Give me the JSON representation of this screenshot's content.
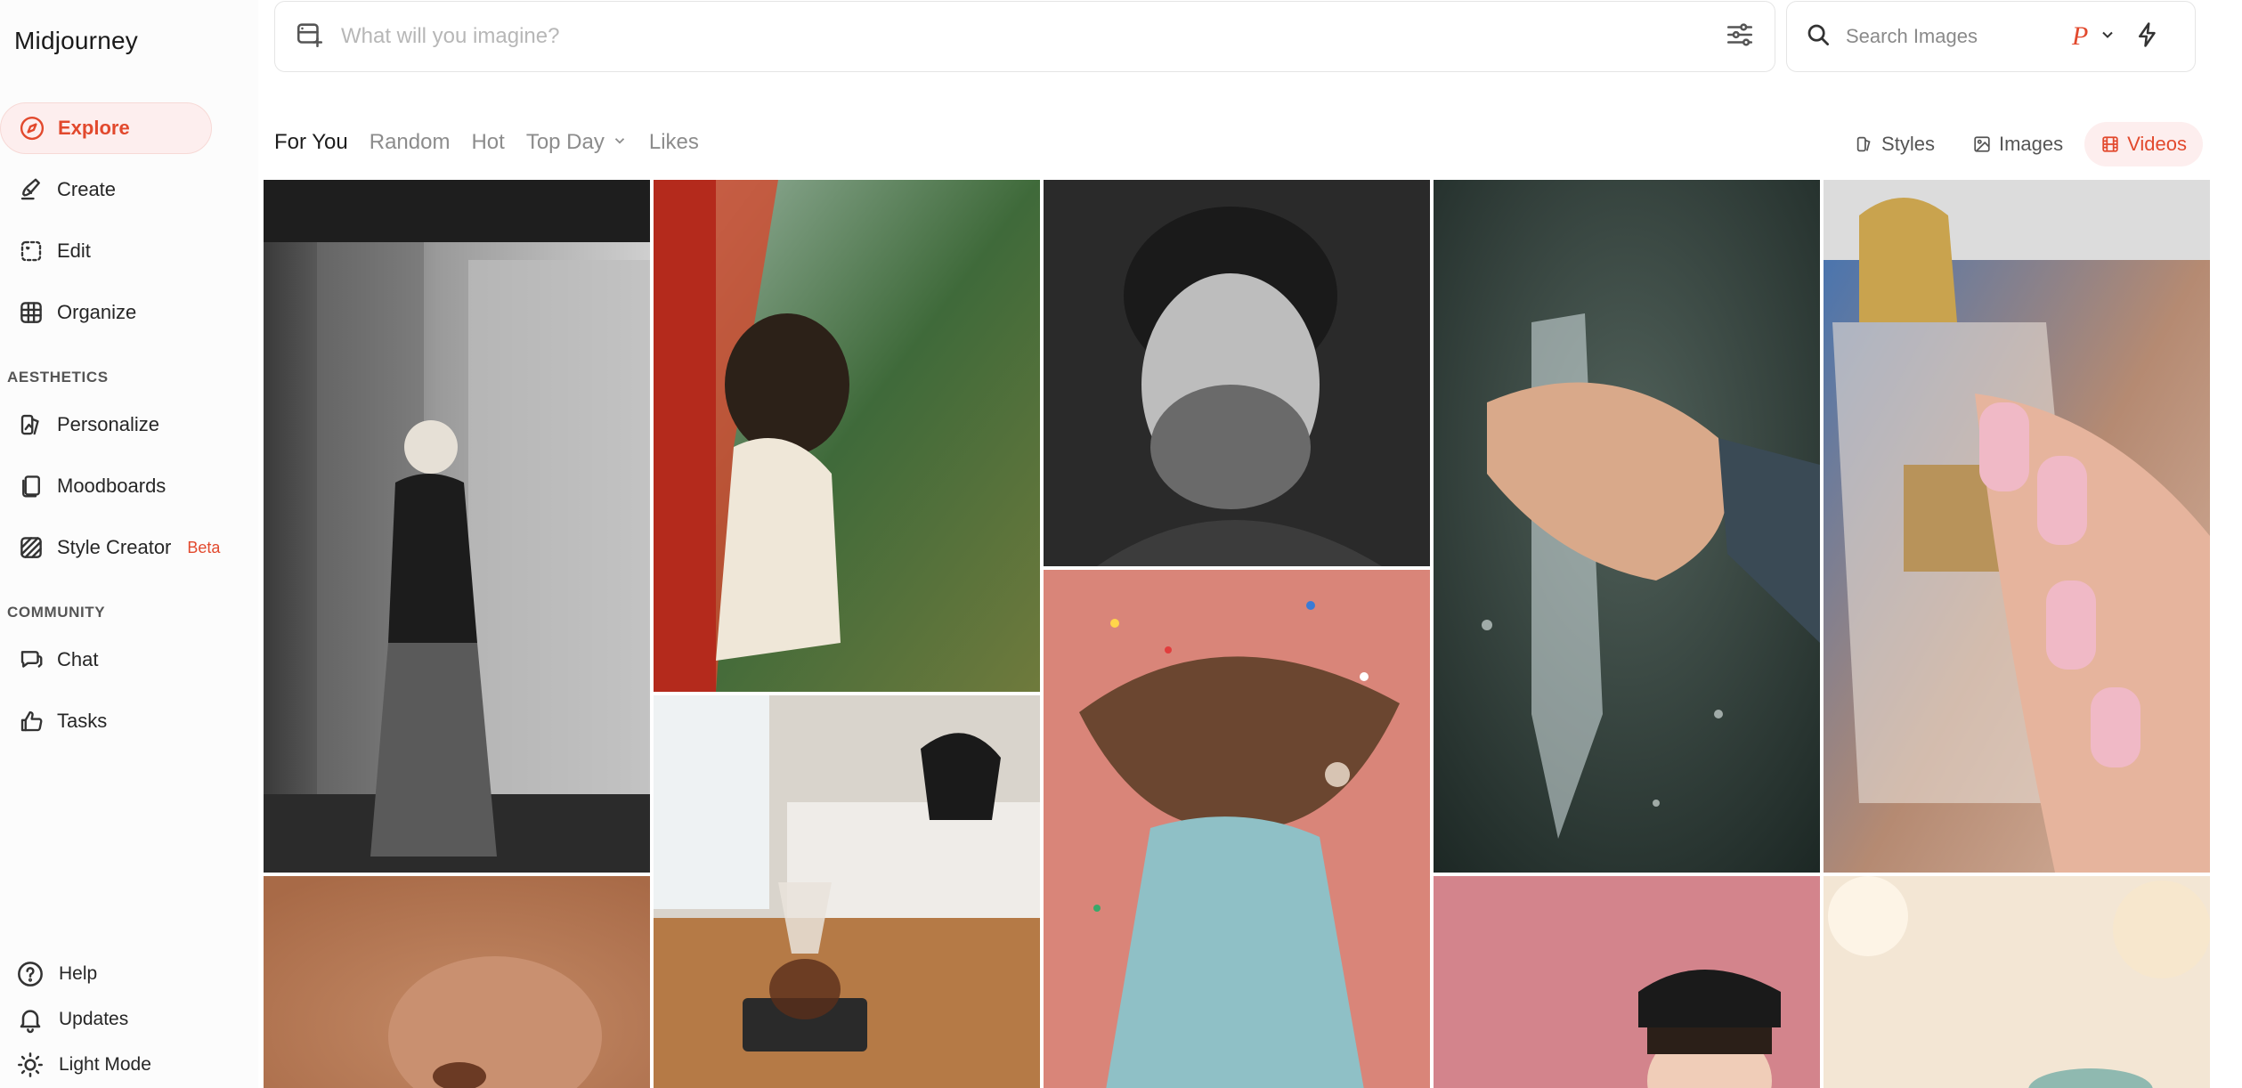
{
  "brand": "Midjourney",
  "nav": {
    "explore": "Explore",
    "create": "Create",
    "edit": "Edit",
    "organize": "Organize",
    "aesthetics_heading": "AESTHETICS",
    "personalize": "Personalize",
    "moodboards": "Moodboards",
    "style_creator": "Style Creator",
    "beta_badge": "Beta",
    "community_heading": "COMMUNITY",
    "chat": "Chat",
    "tasks": "Tasks"
  },
  "footer": {
    "help": "Help",
    "updates": "Updates",
    "light_mode": "Light Mode"
  },
  "prompt": {
    "placeholder": "What will you imagine?",
    "value": ""
  },
  "search": {
    "placeholder": "Search Images",
    "value": "",
    "profile_initial": "P"
  },
  "tabs": {
    "for_you": "For You",
    "random": "Random",
    "hot": "Hot",
    "top_day": "Top Day",
    "likes": "Likes",
    "active": "For You"
  },
  "filters": {
    "styles": "Styles",
    "images": "Images",
    "videos": "Videos",
    "active": "Videos"
  },
  "icons": {
    "explore": "compass-icon",
    "create": "brush-icon",
    "edit": "edit-selection-icon",
    "organize": "grid-icon",
    "personalize": "personalize-icon",
    "moodboards": "moodboards-icon",
    "style_creator": "style-creator-icon",
    "chat": "chat-icon",
    "tasks": "thumbs-up-icon",
    "help": "help-icon",
    "updates": "bell-icon",
    "light_mode": "sun-icon"
  },
  "colors": {
    "accent": "#e2492d",
    "accent_bg": "#fdeeee"
  },
  "gallery": {
    "tiles": [
      {
        "name": "woman-by-train-bw"
      },
      {
        "name": "girl-leaning-from-train-window"
      },
      {
        "name": "smiling-bearded-man-bw"
      },
      {
        "name": "hand-with-water-bottle-splash"
      },
      {
        "name": "manicured-nails-perfume-bottle"
      },
      {
        "name": "pour-over-coffee-kettle"
      },
      {
        "name": "hair-flip-confetti"
      },
      {
        "name": "close-up-freckled-nose"
      },
      {
        "name": "girl-in-black-beret"
      },
      {
        "name": "bokeh-soft-light"
      }
    ]
  }
}
